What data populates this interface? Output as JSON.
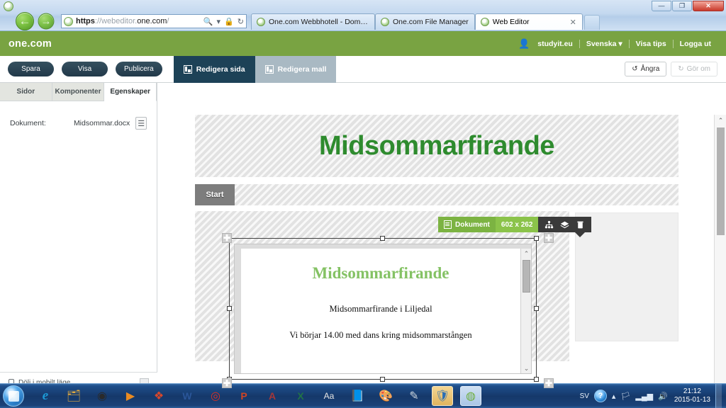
{
  "browser": {
    "window_controls": {
      "minimize": "—",
      "maximize": "❐",
      "close": "✕"
    },
    "nav": {
      "back": "←",
      "forward": "→"
    },
    "address": {
      "scheme": "https",
      "separator": "://",
      "host_pre": "webeditor.",
      "host_brand": "one.com",
      "path": "/"
    },
    "address_icons": {
      "search": "🔍",
      "dropdown": "▾",
      "lock": "🔒",
      "refresh": "↻"
    },
    "tabs": [
      {
        "label": "One.com Webbhotell  -  Domä...",
        "active": false,
        "closable": false
      },
      {
        "label": "One.com File Manager",
        "active": false,
        "closable": false
      },
      {
        "label": "Web Editor",
        "active": true,
        "closable": true,
        "close_glyph": "✕"
      }
    ]
  },
  "app": {
    "logo": "one.com",
    "account": {
      "user_icon": "person-icon",
      "username": "studyit.eu",
      "language": "Svenska",
      "language_caret": "▾",
      "tips": "Visa tips",
      "logout": "Logga ut"
    },
    "toolbar": {
      "save": "Spara",
      "view": "Visa",
      "publish": "Publicera",
      "tabs": [
        {
          "label": "Redigera sida",
          "active": true
        },
        {
          "label": "Redigera mall",
          "active": false
        }
      ],
      "undo": {
        "label": "Ångra",
        "glyph": "↺",
        "enabled": true
      },
      "redo": {
        "label": "Gör om",
        "glyph": "↻",
        "enabled": false
      }
    },
    "sidebar": {
      "tabs": [
        {
          "label": "Sidor",
          "active": false
        },
        {
          "label": "Komponenter",
          "active": false
        },
        {
          "label": "Egenskaper",
          "active": true
        }
      ],
      "properties": [
        {
          "label": "Dokument:",
          "value": "Midsommar.docx",
          "button_icon": "document-icon"
        }
      ],
      "footer": {
        "label": "Dölj i mobilt läge",
        "checked": false
      }
    },
    "page": {
      "title": "Midsommarfirande",
      "nav_items": [
        "Start"
      ]
    },
    "widget_toolbar": {
      "type_label": "Dokument",
      "size_label": "602 x 262",
      "actions": [
        {
          "name": "sitemap-icon",
          "title": "sitemap"
        },
        {
          "name": "layers-icon",
          "title": "layers"
        },
        {
          "name": "trash-icon",
          "title": "delete"
        }
      ]
    },
    "document_preview": {
      "heading": "Midsommarfirande",
      "paragraphs": [
        "Midsommarfirande i Liljedal",
        "Vi börjar 14.00 med dans kring midsommarstången"
      ],
      "scroll_up": "⌃",
      "scroll_down": "⌄"
    },
    "canvas_scroll": {
      "up": "⌃",
      "down": "⌄"
    },
    "colors": {
      "brand_green": "#79a342",
      "dark_navy": "#1d4257",
      "widget_green": "#7cb342",
      "page_title_green": "#2e8b2e",
      "doc_heading_green": "#84c264"
    }
  },
  "taskbar": {
    "start": "start-orb",
    "items": [
      {
        "name": "taskbar-internet-explorer",
        "glyph": "e"
      },
      {
        "name": "taskbar-windows-explorer",
        "glyph": "🗂"
      },
      {
        "name": "taskbar-media-center",
        "glyph": "◉"
      },
      {
        "name": "taskbar-media-player",
        "glyph": "▶"
      },
      {
        "name": "taskbar-office",
        "glyph": "❖"
      },
      {
        "name": "taskbar-word",
        "glyph": "W"
      },
      {
        "name": "taskbar-chrome",
        "glyph": "◎"
      },
      {
        "name": "taskbar-powerpoint",
        "glyph": "P"
      },
      {
        "name": "taskbar-access",
        "glyph": "A"
      },
      {
        "name": "taskbar-excel",
        "glyph": "X"
      },
      {
        "name": "taskbar-acrobat",
        "glyph": "Aa"
      },
      {
        "name": "taskbar-notes",
        "glyph": "📘"
      },
      {
        "name": "taskbar-paint",
        "glyph": "🎨"
      },
      {
        "name": "taskbar-snipping-tool",
        "glyph": "✎"
      },
      {
        "name": "taskbar-security-shield",
        "glyph": "🛡"
      },
      {
        "name": "taskbar-onecom-window",
        "glyph": "◍"
      }
    ],
    "tray": {
      "language": "SV",
      "help": "?",
      "expand": "▴",
      "action_center": "🏳",
      "network": "▂▄▆",
      "volume": "🔊",
      "time": "21:12",
      "date": "2015-01-13"
    }
  }
}
